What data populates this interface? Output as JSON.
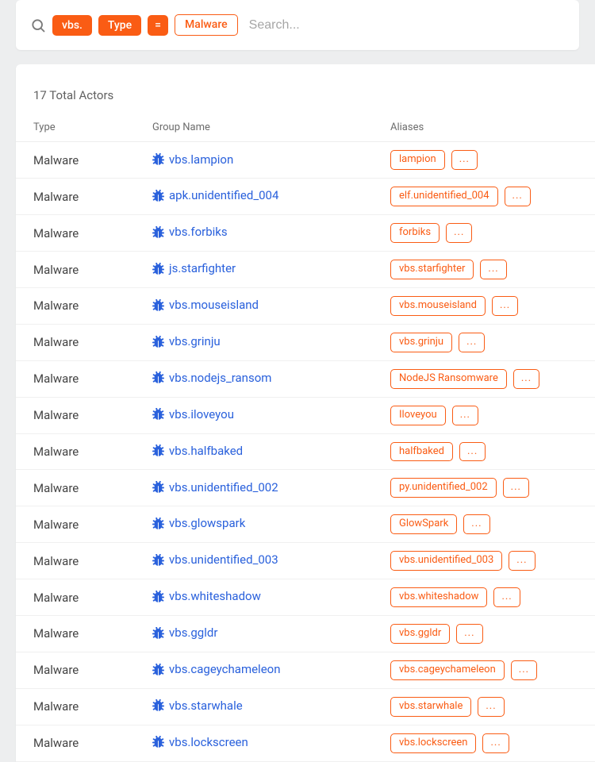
{
  "search": {
    "placeholder": "Search...",
    "value": "",
    "chips": {
      "prefix": "vbs.",
      "field": "Type",
      "operator": "=",
      "value": "Malware"
    }
  },
  "results": {
    "count_text": "17 Total Actors",
    "headers": {
      "type": "Type",
      "group": "Group Name",
      "aliases": "Aliases"
    },
    "more_label": "...",
    "rows": [
      {
        "type": "Malware",
        "group": "vbs.lampion",
        "alias": "lampion"
      },
      {
        "type": "Malware",
        "group": "apk.unidentified_004",
        "alias": "elf.unidentified_004"
      },
      {
        "type": "Malware",
        "group": "vbs.forbiks",
        "alias": "forbiks"
      },
      {
        "type": "Malware",
        "group": "js.starfighter",
        "alias": "vbs.starfighter"
      },
      {
        "type": "Malware",
        "group": "vbs.mouseisland",
        "alias": "vbs.mouseisland"
      },
      {
        "type": "Malware",
        "group": "vbs.grinju",
        "alias": "vbs.grinju"
      },
      {
        "type": "Malware",
        "group": "vbs.nodejs_ransom",
        "alias": "NodeJS Ransomware"
      },
      {
        "type": "Malware",
        "group": "vbs.iloveyou",
        "alias": "Iloveyou"
      },
      {
        "type": "Malware",
        "group": "vbs.halfbaked",
        "alias": "halfbaked"
      },
      {
        "type": "Malware",
        "group": "vbs.unidentified_002",
        "alias": "py.unidentified_002"
      },
      {
        "type": "Malware",
        "group": "vbs.glowspark",
        "alias": "GlowSpark"
      },
      {
        "type": "Malware",
        "group": "vbs.unidentified_003",
        "alias": "vbs.unidentified_003"
      },
      {
        "type": "Malware",
        "group": "vbs.whiteshadow",
        "alias": "vbs.whiteshadow"
      },
      {
        "type": "Malware",
        "group": "vbs.ggldr",
        "alias": "vbs.ggldr"
      },
      {
        "type": "Malware",
        "group": "vbs.cageychameleon",
        "alias": "vbs.cageychameleon"
      },
      {
        "type": "Malware",
        "group": "vbs.starwhale",
        "alias": "vbs.starwhale"
      },
      {
        "type": "Malware",
        "group": "vbs.lockscreen",
        "alias": "vbs.lockscreen"
      }
    ]
  },
  "colors": {
    "accent": "#fa5c14",
    "link": "#2a61dc"
  }
}
